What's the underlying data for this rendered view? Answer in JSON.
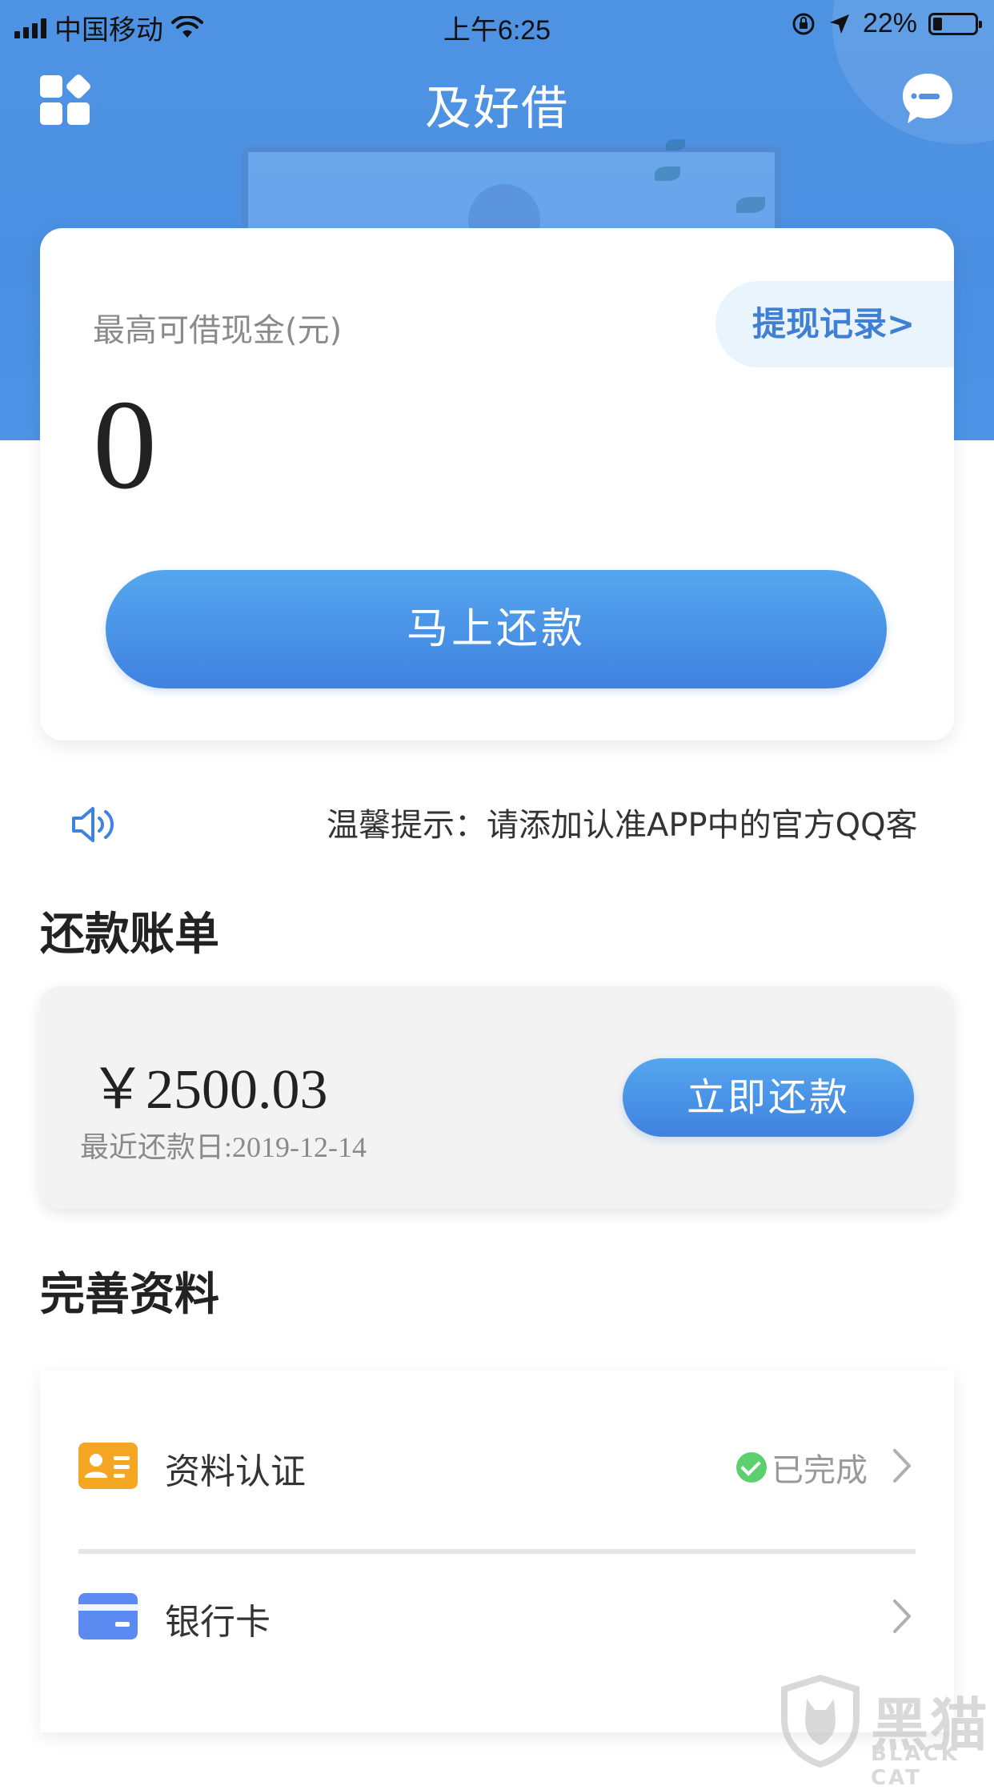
{
  "status_bar": {
    "carrier": "中国移动",
    "time": "上午6:25",
    "battery": "22%",
    "battery_level": 0.22
  },
  "nav": {
    "title": "及好借",
    "apps_icon": "apps-grid-icon",
    "message_icon": "message-bubble-icon"
  },
  "loan_card": {
    "label": "最高可借现金(元)",
    "record_link": "提现记录>",
    "amount": "0",
    "repay_button": "马上还款"
  },
  "notice": {
    "icon": "speaker-icon",
    "text": "温馨提示：请添加认准APP中的官方QQ客"
  },
  "bill_section": {
    "title": "还款账单",
    "amount": "￥2500.03",
    "due_date": "最近还款日:2019-12-14",
    "repay_button": "立即还款"
  },
  "profile_section": {
    "title": "完善资料",
    "items": [
      {
        "label": "资料认证",
        "status": "已完成",
        "icon": "id-card-icon",
        "icon_color": "#f5a623"
      },
      {
        "label": "银行卡",
        "status": "",
        "icon": "bank-card-icon",
        "icon_color": "#5b8bf0"
      }
    ]
  },
  "watermark": {
    "text_cn": "黑猫",
    "text_en": "BLACK CAT"
  },
  "colors": {
    "header_blue": "#4f93e3",
    "button_blue": "#3f82e0",
    "link_blue": "#3f7fd4",
    "success_green": "#5ccf6e"
  }
}
